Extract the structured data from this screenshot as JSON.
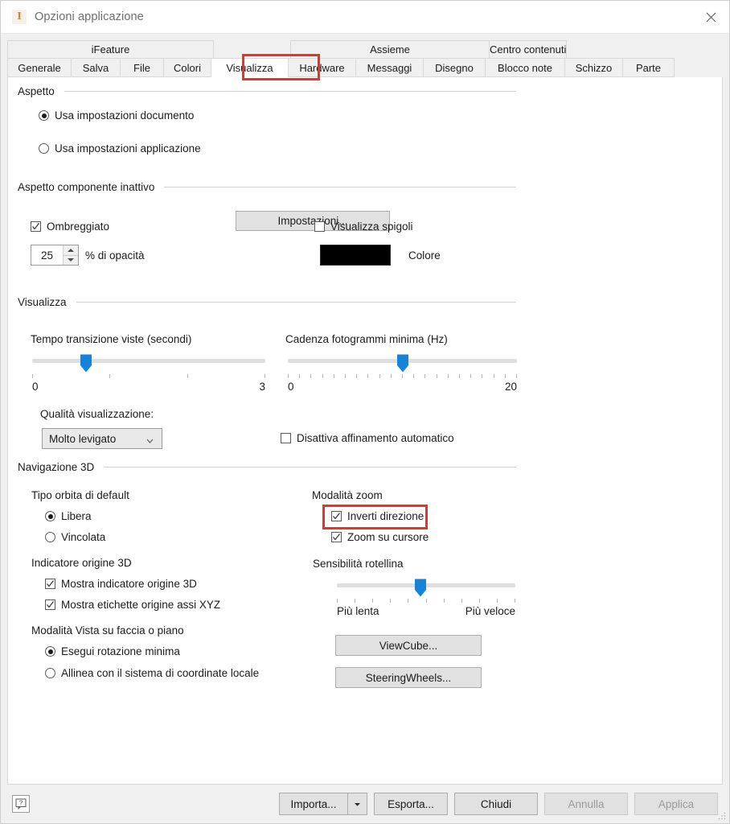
{
  "window": {
    "title": "Opzioni applicazione",
    "icon": "inventor-i-icon",
    "icon_glyph": "I",
    "close_icon": "close-icon",
    "accent_red": "#ef3124",
    "title_color": "#6e6e6e"
  },
  "tabs": {
    "groups": [
      {
        "label": "iFeature",
        "span": 4
      },
      {
        "label": "",
        "span": 1,
        "blank": true
      },
      {
        "label": "Assieme",
        "span": 3
      },
      {
        "label": "Centro contenuti",
        "span": 4
      }
    ],
    "items": [
      {
        "label": "Generale",
        "active": false
      },
      {
        "label": "Salva",
        "active": false
      },
      {
        "label": "File",
        "active": false
      },
      {
        "label": "Colori",
        "active": false
      },
      {
        "label": "Visualizza",
        "active": true
      },
      {
        "label": "Hardware",
        "active": false
      },
      {
        "label": "Messaggi",
        "active": false
      },
      {
        "label": "Disegno",
        "active": false
      },
      {
        "label": "Blocco note",
        "active": false
      },
      {
        "label": "Schizzo",
        "active": false
      },
      {
        "label": "Parte",
        "active": false
      }
    ]
  },
  "aspetto": {
    "title": "Aspetto",
    "radio_documento": {
      "label": "Usa impostazioni documento",
      "checked": true
    },
    "radio_applicazione": {
      "label": "Usa impostazioni applicazione",
      "checked": false
    },
    "button_impostazioni": "Impostazioni..."
  },
  "componente_inattivo": {
    "title": "Aspetto componente inattivo",
    "check_ombreggiato": {
      "label": "Ombreggiato",
      "checked": true
    },
    "check_spigoli": {
      "label": "Visualizza spigoli",
      "checked": false
    },
    "opacity_value": "25",
    "opacity_label": "% di opacità",
    "color_label": "Colore",
    "color_value": "#000000"
  },
  "visualizza": {
    "title": "Visualizza",
    "slider_transizione": {
      "label": "Tempo transizione viste (secondi)",
      "min": "0",
      "max": "3",
      "ticks": 4,
      "value_pct": 23
    },
    "slider_fotogrammi": {
      "label": "Cadenza fotogrammi minima (Hz)",
      "min": "0",
      "max": "20",
      "ticks": 21,
      "value_pct": 50
    },
    "qualita_label": "Qualità visualizzazione:",
    "qualita_value": "Molto levigato",
    "check_affinamento": {
      "label": "Disattiva affinamento automatico",
      "checked": false
    }
  },
  "navigazione": {
    "title": "Navigazione 3D",
    "orbita_label": "Tipo orbita di default",
    "radio_libera": {
      "label": "Libera",
      "checked": true
    },
    "radio_vincolata": {
      "label": "Vincolata",
      "checked": false
    },
    "indicatore_label": "Indicatore origine 3D",
    "check_indicatore": {
      "label": "Mostra indicatore origine 3D",
      "checked": true
    },
    "check_etichette": {
      "label": "Mostra etichette origine assi XYZ",
      "checked": true
    },
    "vista_label": "Modalità Vista su faccia o piano",
    "radio_rotazione": {
      "label": "Esegui rotazione minima",
      "checked": true
    },
    "radio_allinea": {
      "label": "Allinea con il sistema di coordinate locale",
      "checked": false
    },
    "zoom_label": "Modalità zoom",
    "check_inverti": {
      "label": "Inverti direzione",
      "checked": true
    },
    "check_zoomcursore": {
      "label": "Zoom su cursore",
      "checked": true
    },
    "sensibilita_label": "Sensibilità rotellina",
    "slider_sensibilita": {
      "min": "Più lenta",
      "max": "Più veloce",
      "ticks": 11,
      "value_pct": 47
    },
    "button_viewcube": "ViewCube...",
    "button_steeringwheels": "SteeringWheels..."
  },
  "footer": {
    "help_icon": "help-question-icon",
    "import_label": "Importa...",
    "import_arrow_icon": "chevron-down-icon",
    "export_label": "Esporta...",
    "close_label": "Chiudi",
    "cancel_label": "Annulla",
    "apply_label": "Applica",
    "cancel_disabled": true,
    "apply_disabled": true
  }
}
